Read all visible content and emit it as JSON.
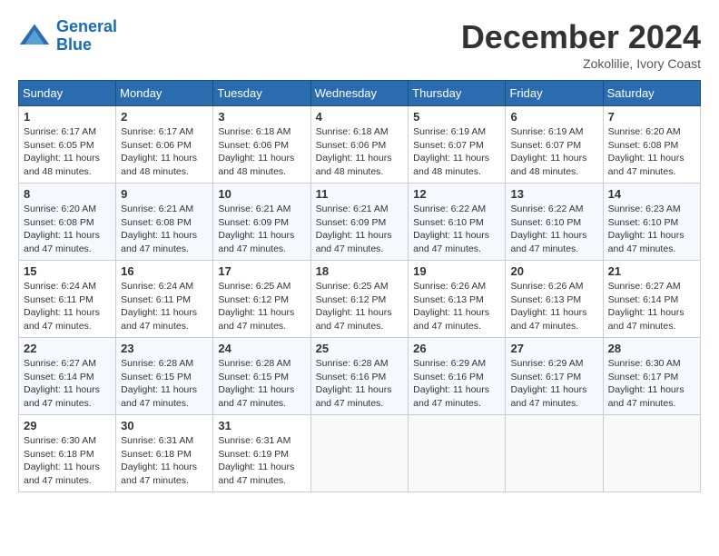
{
  "header": {
    "logo_line1": "General",
    "logo_line2": "Blue",
    "month": "December 2024",
    "location": "Zokolilie, Ivory Coast"
  },
  "days_of_week": [
    "Sunday",
    "Monday",
    "Tuesday",
    "Wednesday",
    "Thursday",
    "Friday",
    "Saturday"
  ],
  "weeks": [
    [
      {
        "day": 1,
        "info": "Sunrise: 6:17 AM\nSunset: 6:05 PM\nDaylight: 11 hours\nand 48 minutes."
      },
      {
        "day": 2,
        "info": "Sunrise: 6:17 AM\nSunset: 6:06 PM\nDaylight: 11 hours\nand 48 minutes."
      },
      {
        "day": 3,
        "info": "Sunrise: 6:18 AM\nSunset: 6:06 PM\nDaylight: 11 hours\nand 48 minutes."
      },
      {
        "day": 4,
        "info": "Sunrise: 6:18 AM\nSunset: 6:06 PM\nDaylight: 11 hours\nand 48 minutes."
      },
      {
        "day": 5,
        "info": "Sunrise: 6:19 AM\nSunset: 6:07 PM\nDaylight: 11 hours\nand 48 minutes."
      },
      {
        "day": 6,
        "info": "Sunrise: 6:19 AM\nSunset: 6:07 PM\nDaylight: 11 hours\nand 48 minutes."
      },
      {
        "day": 7,
        "info": "Sunrise: 6:20 AM\nSunset: 6:08 PM\nDaylight: 11 hours\nand 47 minutes."
      }
    ],
    [
      {
        "day": 8,
        "info": "Sunrise: 6:20 AM\nSunset: 6:08 PM\nDaylight: 11 hours\nand 47 minutes."
      },
      {
        "day": 9,
        "info": "Sunrise: 6:21 AM\nSunset: 6:08 PM\nDaylight: 11 hours\nand 47 minutes."
      },
      {
        "day": 10,
        "info": "Sunrise: 6:21 AM\nSunset: 6:09 PM\nDaylight: 11 hours\nand 47 minutes."
      },
      {
        "day": 11,
        "info": "Sunrise: 6:21 AM\nSunset: 6:09 PM\nDaylight: 11 hours\nand 47 minutes."
      },
      {
        "day": 12,
        "info": "Sunrise: 6:22 AM\nSunset: 6:10 PM\nDaylight: 11 hours\nand 47 minutes."
      },
      {
        "day": 13,
        "info": "Sunrise: 6:22 AM\nSunset: 6:10 PM\nDaylight: 11 hours\nand 47 minutes."
      },
      {
        "day": 14,
        "info": "Sunrise: 6:23 AM\nSunset: 6:10 PM\nDaylight: 11 hours\nand 47 minutes."
      }
    ],
    [
      {
        "day": 15,
        "info": "Sunrise: 6:24 AM\nSunset: 6:11 PM\nDaylight: 11 hours\nand 47 minutes."
      },
      {
        "day": 16,
        "info": "Sunrise: 6:24 AM\nSunset: 6:11 PM\nDaylight: 11 hours\nand 47 minutes."
      },
      {
        "day": 17,
        "info": "Sunrise: 6:25 AM\nSunset: 6:12 PM\nDaylight: 11 hours\nand 47 minutes."
      },
      {
        "day": 18,
        "info": "Sunrise: 6:25 AM\nSunset: 6:12 PM\nDaylight: 11 hours\nand 47 minutes."
      },
      {
        "day": 19,
        "info": "Sunrise: 6:26 AM\nSunset: 6:13 PM\nDaylight: 11 hours\nand 47 minutes."
      },
      {
        "day": 20,
        "info": "Sunrise: 6:26 AM\nSunset: 6:13 PM\nDaylight: 11 hours\nand 47 minutes."
      },
      {
        "day": 21,
        "info": "Sunrise: 6:27 AM\nSunset: 6:14 PM\nDaylight: 11 hours\nand 47 minutes."
      }
    ],
    [
      {
        "day": 22,
        "info": "Sunrise: 6:27 AM\nSunset: 6:14 PM\nDaylight: 11 hours\nand 47 minutes."
      },
      {
        "day": 23,
        "info": "Sunrise: 6:28 AM\nSunset: 6:15 PM\nDaylight: 11 hours\nand 47 minutes."
      },
      {
        "day": 24,
        "info": "Sunrise: 6:28 AM\nSunset: 6:15 PM\nDaylight: 11 hours\nand 47 minutes."
      },
      {
        "day": 25,
        "info": "Sunrise: 6:28 AM\nSunset: 6:16 PM\nDaylight: 11 hours\nand 47 minutes."
      },
      {
        "day": 26,
        "info": "Sunrise: 6:29 AM\nSunset: 6:16 PM\nDaylight: 11 hours\nand 47 minutes."
      },
      {
        "day": 27,
        "info": "Sunrise: 6:29 AM\nSunset: 6:17 PM\nDaylight: 11 hours\nand 47 minutes."
      },
      {
        "day": 28,
        "info": "Sunrise: 6:30 AM\nSunset: 6:17 PM\nDaylight: 11 hours\nand 47 minutes."
      }
    ],
    [
      {
        "day": 29,
        "info": "Sunrise: 6:30 AM\nSunset: 6:18 PM\nDaylight: 11 hours\nand 47 minutes."
      },
      {
        "day": 30,
        "info": "Sunrise: 6:31 AM\nSunset: 6:18 PM\nDaylight: 11 hours\nand 47 minutes."
      },
      {
        "day": 31,
        "info": "Sunrise: 6:31 AM\nSunset: 6:19 PM\nDaylight: 11 hours\nand 47 minutes."
      },
      null,
      null,
      null,
      null
    ]
  ]
}
